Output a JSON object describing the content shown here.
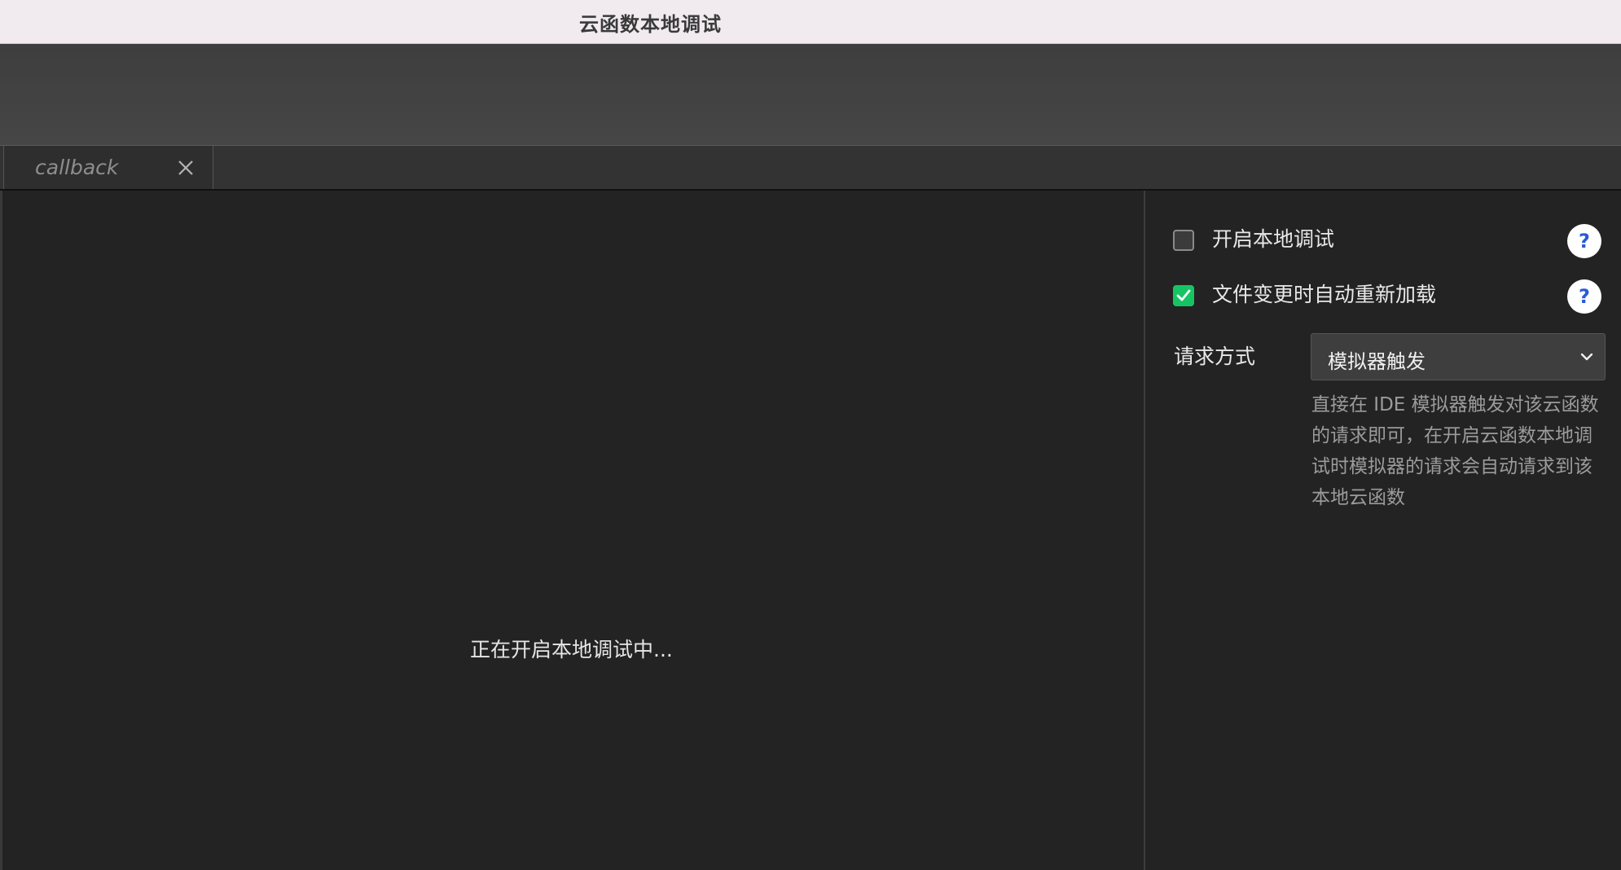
{
  "window": {
    "title": "云函数本地调试"
  },
  "tabs": [
    {
      "label": "callback",
      "close_icon": "close-icon"
    }
  ],
  "editor": {
    "status_text": "正在开启本地调试中..."
  },
  "panel": {
    "options": [
      {
        "label": "开启本地调试",
        "checked": false,
        "help": "?"
      },
      {
        "label": "文件变更时自动重新加载",
        "checked": true,
        "help": "?"
      }
    ],
    "request_method": {
      "label": "请求方式",
      "selected": "模拟器触发",
      "description": "直接在 IDE 模拟器触发对该云函数的请求即可，在开启云函数本地调试时模拟器的请求会自动请求到该本地云函数"
    }
  },
  "colors": {
    "checkbox_on": "#16c464",
    "help_icon": "#2a5bd7",
    "titlebar": "#f1eaee",
    "background": "#232323"
  }
}
